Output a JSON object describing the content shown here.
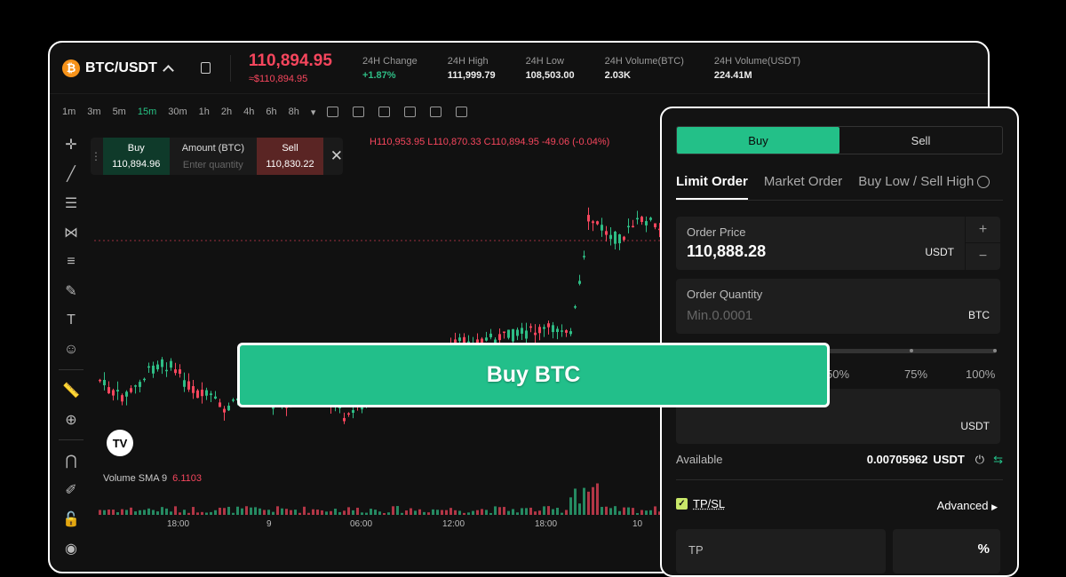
{
  "header": {
    "pair": "BTC/USDT",
    "coin_icon_glyph": "₿",
    "last_price": "110,894.95",
    "last_price_fiat": "≈$110,894.95",
    "stats": [
      {
        "label": "24H Change",
        "value": "+1.87%"
      },
      {
        "label": "24H High",
        "value": "111,999.79"
      },
      {
        "label": "24H Low",
        "value": "108,503.00"
      },
      {
        "label": "24H Volume(BTC)",
        "value": "2.03K"
      },
      {
        "label": "24H Volume(USDT)",
        "value": "224.41M"
      }
    ]
  },
  "toolbar": {
    "intervals": [
      "1m",
      "3m",
      "5m",
      "15m",
      "30m",
      "1h",
      "2h",
      "4h",
      "6h",
      "8h"
    ],
    "active_interval": "15m"
  },
  "quick_trade": {
    "buy_label": "Buy",
    "buy_price": "110,894.96",
    "amount_label": "Amount (BTC)",
    "amount_placeholder": "Enter quantity",
    "sell_label": "Sell",
    "sell_price": "110,830.22"
  },
  "ohlc": "H110,953.95  L110,870.33  C110,894.95  -49.06 (-0.04%)",
  "volume": {
    "label": "Volume SMA 9",
    "value": "6.1103"
  },
  "tv_logo": "TV",
  "x_axis": [
    "18:00",
    "9",
    "06:00",
    "12:00",
    "18:00",
    "10"
  ],
  "colors": {
    "up": "#2ebd85",
    "down": "#f6465d",
    "accent": "#23c088"
  },
  "order_panel": {
    "side_buy": "Buy",
    "side_sell": "Sell",
    "tabs": [
      "Limit Order",
      "Market Order",
      "Buy Low / Sell High"
    ],
    "price_label": "Order Price",
    "price_value": "110,888.28",
    "price_unit": "USDT",
    "qty_label": "Order Quantity",
    "qty_placeholder": "Min.0.0001",
    "qty_unit": "BTC",
    "pcts": [
      "50%",
      "75%",
      "100%"
    ],
    "amount_unit": "USDT",
    "available_label": "Available",
    "available_value": "0.00705962",
    "available_unit": "USDT",
    "tpsl_label": "TP/SL",
    "advanced_label": "Advanced",
    "tp_label": "TP",
    "tp_unit": "%"
  },
  "cta": "Buy BTC",
  "chart_data": {
    "type": "candlestick",
    "x": [
      "18:00",
      "9",
      "06:00",
      "12:00",
      "18:00",
      "10"
    ],
    "close_last": 110894.95,
    "high_last": 110953.95,
    "low_last": 110870.33
  }
}
